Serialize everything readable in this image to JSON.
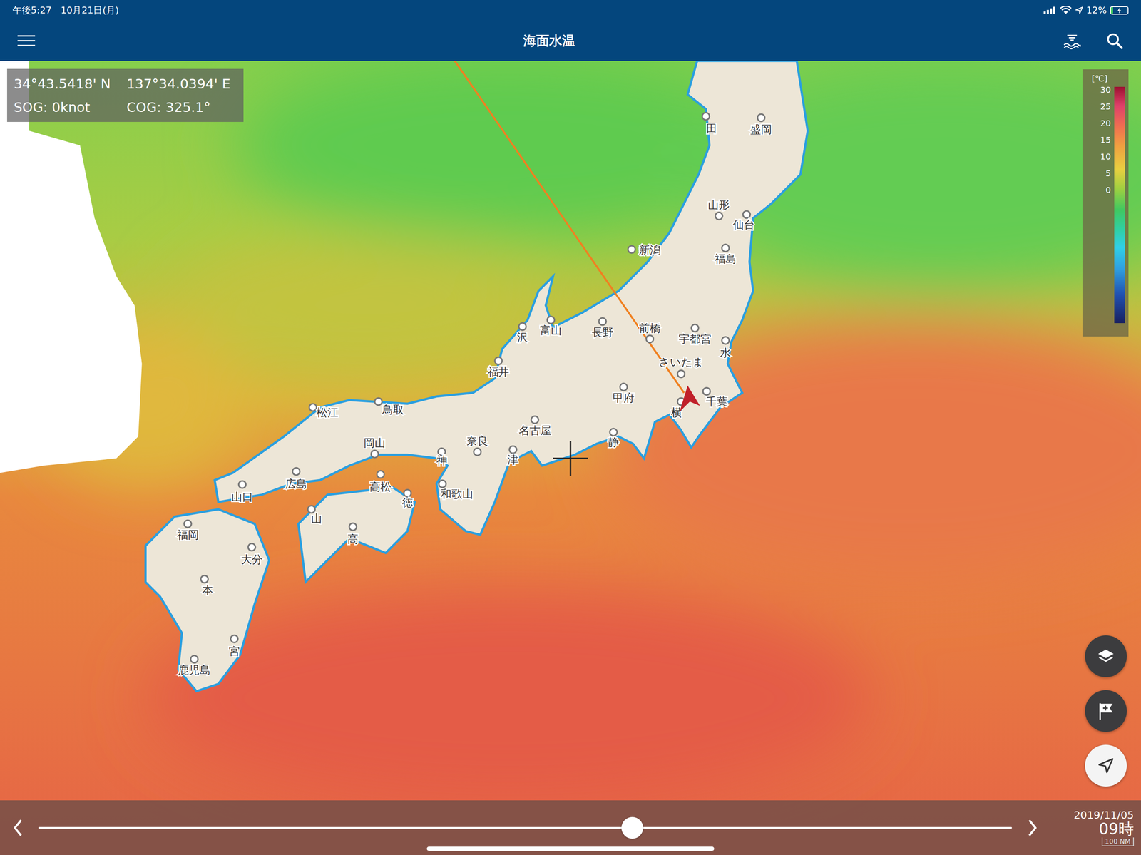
{
  "status_bar": {
    "time": "午後5:27",
    "date": "10月21日(月)",
    "battery": "12%",
    "battery_level": 0.12,
    "charging": true
  },
  "nav_bar": {
    "title": "海面水温"
  },
  "position": {
    "lat": "34°43.5418' N",
    "lon": "137°34.0394' E",
    "sog": "SOG: 0knot",
    "cog": "COG: 325.1°"
  },
  "legend": {
    "unit": "[℃]",
    "ticks": [
      "30",
      "25",
      "20",
      "15",
      "10",
      "5",
      "0"
    ]
  },
  "cities": [
    {
      "name": "田"
    },
    {
      "name": "盛岡"
    },
    {
      "name": "山形"
    },
    {
      "name": "仙台"
    },
    {
      "name": "新潟"
    },
    {
      "name": "福島"
    },
    {
      "name": "前橋"
    },
    {
      "name": "宇都宮"
    },
    {
      "name": "水"
    },
    {
      "name": "長野"
    },
    {
      "name": "富山"
    },
    {
      "name": "沢"
    },
    {
      "name": "福井"
    },
    {
      "name": "さいたま"
    },
    {
      "name": "甲府"
    },
    {
      "name": "千葉"
    },
    {
      "name": "横"
    },
    {
      "name": "静"
    },
    {
      "name": "名古屋"
    },
    {
      "name": "津"
    },
    {
      "name": "鳥取"
    },
    {
      "name": "松江"
    },
    {
      "name": "岡山"
    },
    {
      "name": "神"
    },
    {
      "name": "奈良"
    },
    {
      "name": "和歌山"
    },
    {
      "name": "高松"
    },
    {
      "name": "広島"
    },
    {
      "name": "山口"
    },
    {
      "name": "徳"
    },
    {
      "name": "山"
    },
    {
      "name": "高"
    },
    {
      "name": "福岡"
    },
    {
      "name": "大分"
    },
    {
      "name": "本"
    },
    {
      "name": "宮"
    },
    {
      "name": "鹿児島"
    }
  ],
  "timeline": {
    "level": 0.61,
    "date": "2019/11/05",
    "hour": "09時",
    "scale": "100 NM"
  }
}
